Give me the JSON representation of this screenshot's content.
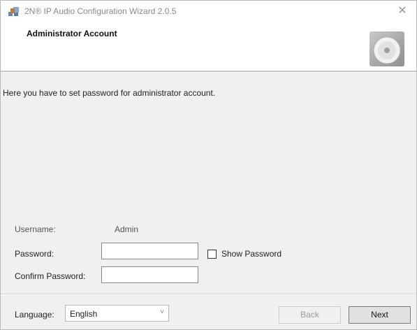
{
  "window": {
    "title": "2N® IP Audio Configuration Wizard 2.0.5",
    "close_glyph": "✕"
  },
  "header": {
    "title": "Administrator Account",
    "icon": "cd-icon"
  },
  "body": {
    "instruction": "Here you have to set password for administrator account.",
    "username_label": "Username:",
    "username_value": "Admin",
    "password_label": "Password:",
    "password_value": "",
    "confirm_label": "Confirm Password:",
    "confirm_value": "",
    "show_password_label": "Show Password",
    "show_password_checked": false
  },
  "footer": {
    "language_label": "Language:",
    "language_value": "English",
    "chevron_glyph": "˅",
    "back_label": "Back",
    "next_label": "Next"
  }
}
